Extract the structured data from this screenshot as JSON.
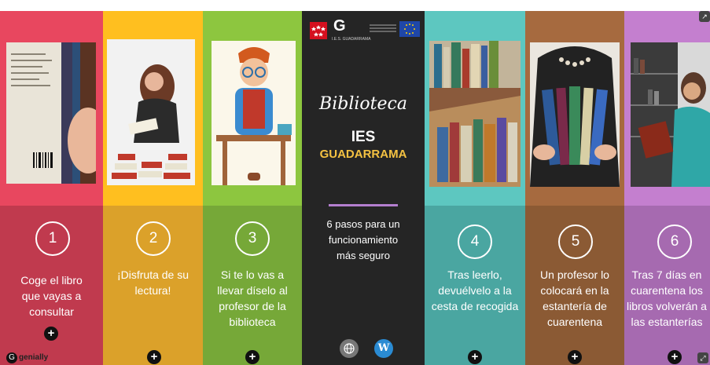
{
  "center": {
    "title": "Biblioteca",
    "school": "IES",
    "school_name": "GUADARRAMA",
    "tagline": "6 pasos para un funcionamiento más seguro",
    "logo_letter": "G",
    "logo_caption": "I.E.S. GUADARRAMA",
    "web_icon": "globe-icon",
    "blog_icon": "wordpress-icon"
  },
  "steps": [
    {
      "number": "1",
      "text": "Coge el libro que vayas a consultar",
      "color_top": "#e8475f",
      "color_bottom": "#c03a4e",
      "icon": "plus-icon"
    },
    {
      "number": "2",
      "text": "¡Disfruta de su lectura!",
      "color_top": "#ffbf1f",
      "color_bottom": "#dba12a",
      "icon": "plus-icon"
    },
    {
      "number": "3",
      "text": "Si te lo vas a llevar díselo al profesor de la biblioteca",
      "color_top": "#8dc63f",
      "color_bottom": "#76a838",
      "icon": "plus-icon"
    },
    {
      "number": "4",
      "text": "Tras leerlo, devuélvelo a la cesta de recogida",
      "color_top": "#5dc7c0",
      "color_bottom": "#4aa6a1",
      "icon": "plus-icon"
    },
    {
      "number": "5",
      "text": "Un profesor lo colocará en la estantería de cuarentena",
      "color_top": "#a66a3f",
      "color_bottom": "#8b5a34",
      "icon": "plus-icon"
    },
    {
      "number": "6",
      "text": "Tras 7 días en cuarentena los libros volverán a las estanterías",
      "color_top": "#c47fcf",
      "color_bottom": "#a66ab0",
      "icon": "plus-icon"
    }
  ],
  "footer": {
    "brand": "genially"
  }
}
